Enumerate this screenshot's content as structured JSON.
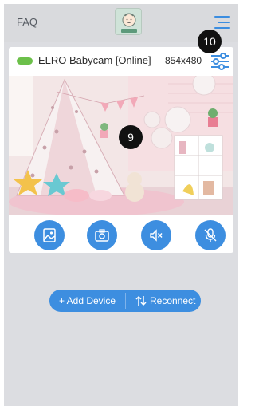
{
  "header": {
    "faq_label": "FAQ",
    "menu_icon": "hamburger-menu-icon",
    "logo_icon": "baby-face-logo"
  },
  "camera": {
    "status": "online",
    "status_color": "#6cc04a",
    "title": "ELRO Babycam [Online]",
    "resolution": "854x480",
    "settings_icon": "sliders-icon"
  },
  "callouts": {
    "video": "9",
    "settings": "10"
  },
  "controls": [
    {
      "icon": "gallery-icon"
    },
    {
      "icon": "camera-icon"
    },
    {
      "icon": "speaker-muted-icon"
    },
    {
      "icon": "microphone-muted-icon"
    }
  ],
  "actions": {
    "add_device_label": "+ Add Device",
    "reconnect_label": "Reconnect",
    "reconnect_icon": "swap-arrows-icon"
  },
  "colors": {
    "accent": "#3d8ee0",
    "background": "#dcdde1"
  }
}
